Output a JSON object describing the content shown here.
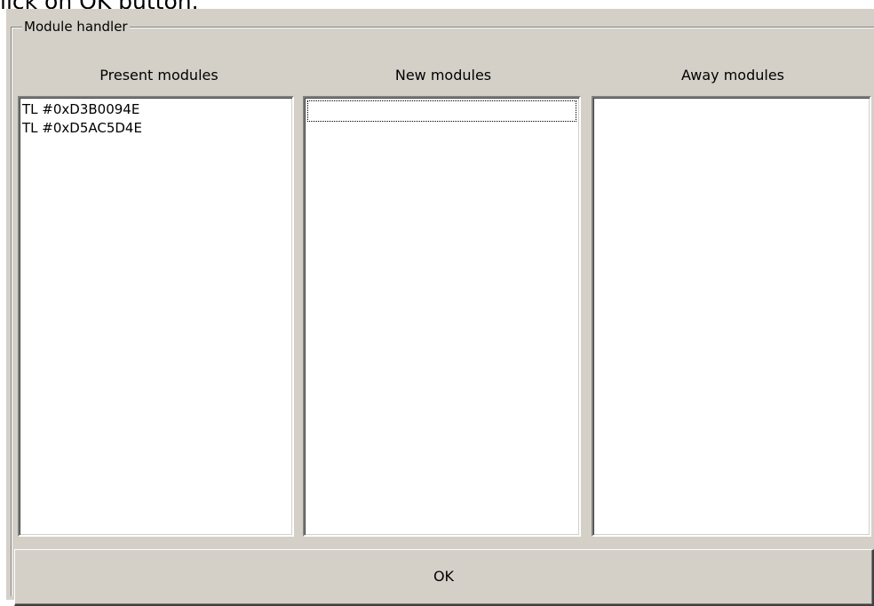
{
  "page": {
    "caption": "lick on OK button."
  },
  "dialog": {
    "group_title": "Module handler",
    "columns": {
      "present": {
        "header": "Present modules",
        "items": [
          "TL #0xD3B0094E",
          "TL #0xD5AC5D4E"
        ]
      },
      "new": {
        "header": "New modules",
        "items": []
      },
      "away": {
        "header": "Away modules",
        "items": []
      }
    },
    "ok_label": "OK"
  }
}
